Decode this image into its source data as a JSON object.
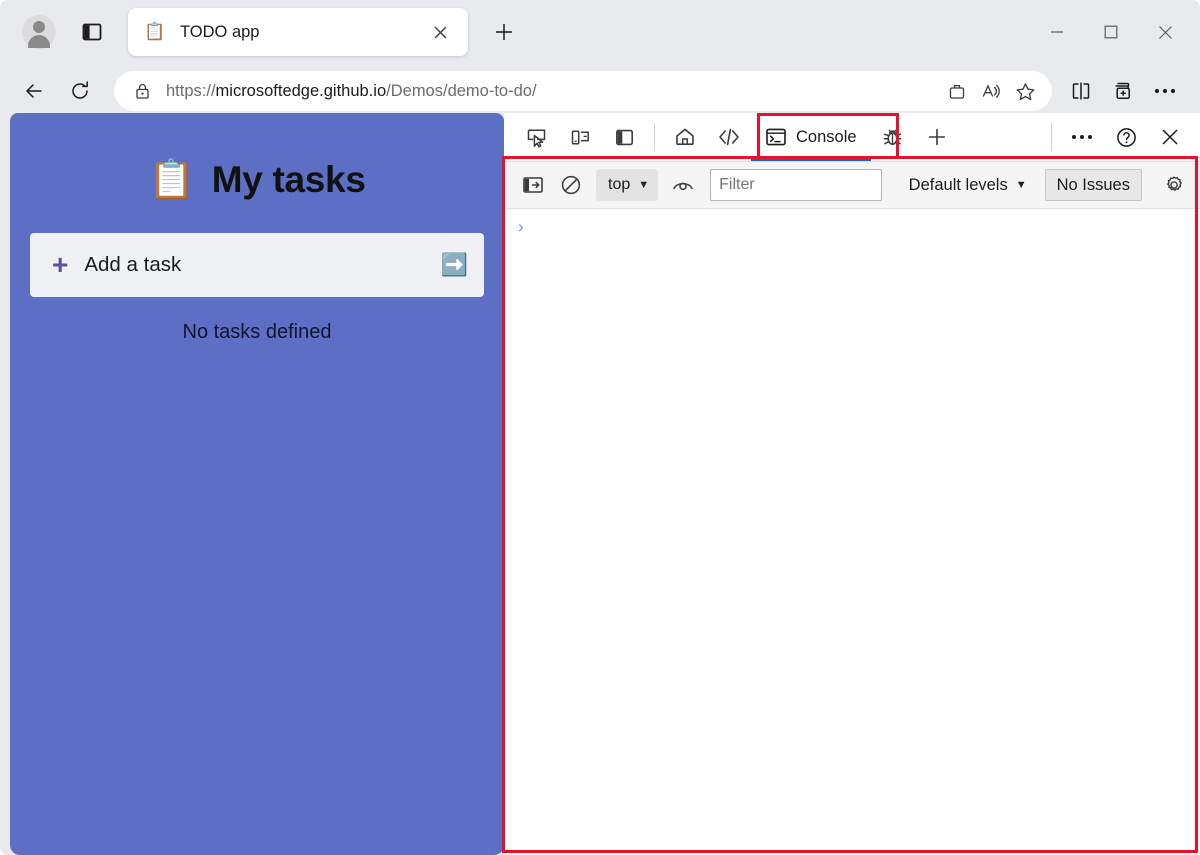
{
  "browser": {
    "profile_icon": "avatar-icon",
    "tabs_list_icon": "vertical-tabs-icon",
    "tab": {
      "favicon": "📋",
      "title": "TODO app",
      "close_icon": "close-icon"
    },
    "new_tab_icon": "plus-icon",
    "window_controls": {
      "minimize": "minimize-icon",
      "maximize": "maximize-icon",
      "close": "close-icon"
    },
    "nav": {
      "back_icon": "back-arrow-icon",
      "refresh_icon": "refresh-icon"
    },
    "omnibox": {
      "lock_icon": "lock-icon",
      "url_scheme": "https://",
      "url_host": "microsoftedge.github.io",
      "url_path": "/Demos/demo-to-do/",
      "url_full": "https://microsoftedge.github.io/Demos/demo-to-do/",
      "shopping_icon": "shopping-bag-icon",
      "read_aloud_icon": "read-aloud-icon",
      "favorite_icon": "star-icon"
    },
    "toolbar": {
      "split_screen_icon": "split-screen-icon",
      "collections_icon": "collections-add-icon",
      "more_icon": "ellipsis-icon"
    }
  },
  "page": {
    "title_emoji": "📋",
    "title": "My tasks",
    "add_task": {
      "plus": "+",
      "placeholder": "Add a task",
      "value": "",
      "submit_emoji": "➡️"
    },
    "empty_message": "No tasks defined",
    "background_color": "#5c6fc5"
  },
  "devtools": {
    "tabbar": {
      "inspect_icon": "inspect-element-icon",
      "device_emulation_icon": "device-emulation-icon",
      "dock_side_icon": "dock-side-icon",
      "welcome_icon": "home-icon",
      "elements_icon": "code-brackets-icon",
      "console_icon": "console-terminal-icon",
      "console_label": "Console",
      "debugger_icon": "bug-icon",
      "more_tabs_icon": "plus-icon",
      "more_tools_icon": "ellipsis-icon",
      "help_icon": "question-circle-icon",
      "close_icon": "close-icon",
      "active_tab": "Console",
      "active_indicator_color": "#0f6cbd"
    },
    "console_toolbar": {
      "sidebar_toggle_icon": "console-sidebar-icon",
      "clear_console_icon": "clear-console-icon",
      "context_label": "top",
      "context_caret": "▼",
      "live_expression_icon": "eye-icon",
      "filter_placeholder": "Filter",
      "filter_value": "",
      "levels_label": "Default levels",
      "levels_caret": "▼",
      "issues_label": "No Issues",
      "settings_icon": "gear-icon"
    },
    "console_body": {
      "prompt": "›",
      "messages": []
    }
  },
  "annotations": {
    "color": "#e8112d",
    "boxes": [
      "console-tab-highlight",
      "console-panel-highlight"
    ]
  }
}
